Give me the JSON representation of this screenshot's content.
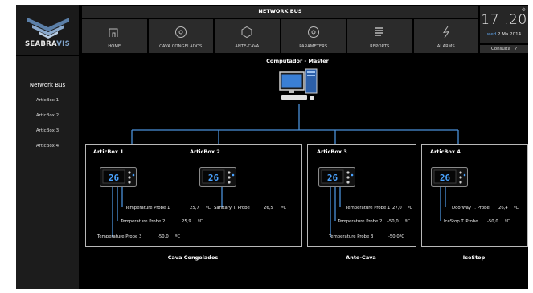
{
  "brand": {
    "name_part1": "SEABRA",
    "name_part2": "VIS"
  },
  "sidebar": {
    "title": "Network Bus",
    "items": [
      {
        "label": "ArticBox 1"
      },
      {
        "label": "ArticBox 2"
      },
      {
        "label": "ArticBox 3"
      },
      {
        "label": "ArticBox 4"
      }
    ]
  },
  "header": {
    "title": "NETWORK BUS"
  },
  "menu": [
    {
      "label": "HOME",
      "icon": "home-icon"
    },
    {
      "label": "CAVA CONGELADOS",
      "icon": "circle-icon"
    },
    {
      "label": "ANTE-CAVA",
      "icon": "hexagon-icon"
    },
    {
      "label": "PARAMETERS",
      "icon": "circle-icon"
    },
    {
      "label": "REPORTS",
      "icon": "reports-icon"
    },
    {
      "label": "ALARMS",
      "icon": "lightning-icon"
    }
  ],
  "clock": {
    "time": "17 :20",
    "day": "wed",
    "date": "2 Ma 2014"
  },
  "consulta": {
    "label": "Consulta",
    "help": "?"
  },
  "network": {
    "master_label": "Computador - Master",
    "boxes": [
      {
        "title": "ArticBox 1",
        "display": "26"
      },
      {
        "title": "ArticBox 2",
        "display": "26"
      },
      {
        "title": "ArticBox 3",
        "display": "26"
      },
      {
        "title": "ArticBox 4",
        "display": "26"
      }
    ],
    "group1": {
      "label": "Cava Congelados",
      "box1_probes": [
        {
          "name": "Temperature Probe 1",
          "value": "25,7",
          "unit": "ºC"
        },
        {
          "name": "Temperature Probe 2",
          "value": "25,9",
          "unit": "ºC"
        },
        {
          "name": "Temperature Probe 3",
          "value": "-50,0",
          "unit": "ºC"
        }
      ],
      "box2_probes": [
        {
          "name": "Sanitary T. Probe",
          "value": "26,5",
          "unit": "ºC"
        }
      ]
    },
    "group2": {
      "label": "Ante-Cava",
      "probes": [
        {
          "name": "Temperature Probe 1",
          "value": "27,0",
          "unit": "ºC"
        },
        {
          "name": "Temperature Probe 2",
          "value": "-50,0",
          "unit": "ºC"
        },
        {
          "name": "Temperature Probe 3",
          "value": "-50,0ºC",
          "unit": ""
        }
      ]
    },
    "group3": {
      "label": "IceStop",
      "probes": [
        {
          "name": "DoorWay T. Probe",
          "value": "26,4",
          "unit": "ºC"
        },
        {
          "name": "IceStop T. Probe",
          "value": "-50,0",
          "unit": "ºC"
        }
      ]
    }
  },
  "colors": {
    "background": "#000000",
    "panel": "#1c1c1c",
    "connector": "#4a90d9",
    "display_digits": "#4aa3ff",
    "brand_accent": "#7fa3c9"
  }
}
